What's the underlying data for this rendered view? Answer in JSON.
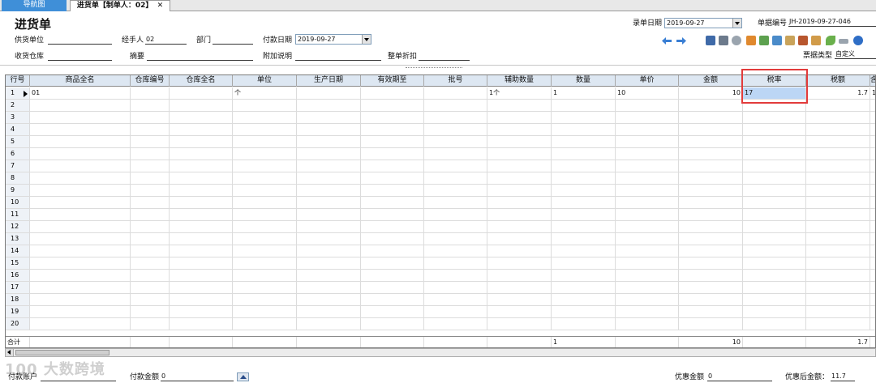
{
  "tabs": {
    "nav": "导航图",
    "doc": "进货单【制单人：02】",
    "close": "✕"
  },
  "page_title": "进货单",
  "header": {
    "entry_date_label": "录单日期",
    "entry_date_value": "2019-09-27",
    "doc_no_label": "单据编号",
    "doc_no_value": "JH-2019-09-27-046",
    "supplier_label": "供货单位",
    "handler_label": "经手人",
    "handler_value": "02",
    "dept_label": "部门",
    "pay_date_label": "付款日期",
    "pay_date_value": "2019-09-27",
    "warehouse_label": "收货仓库",
    "summary_label": "摘要",
    "note_label": "附加说明",
    "discount_label": "整单折扣",
    "bill_type_label": "票据类型",
    "bill_type_value": "自定义"
  },
  "columns": [
    "行号",
    "商品全名",
    "仓库编号",
    "仓库全名",
    "单位",
    "生产日期",
    "有效期至",
    "批号",
    "辅助数量",
    "数量",
    "单价",
    "金额",
    "税率",
    "税额",
    "含"
  ],
  "first_row": {
    "no": "1",
    "product": "01",
    "unit": "个",
    "aux_qty": "1个",
    "qty": "1",
    "price": "10",
    "amount": "10",
    "tax_rate": "17",
    "tax_amount": "1.7",
    "extra": "1"
  },
  "row_numbers": [
    "2",
    "3",
    "4",
    "5",
    "6",
    "7",
    "8",
    "9",
    "10",
    "11",
    "12",
    "13",
    "14",
    "15",
    "16",
    "17",
    "18",
    "19",
    "20"
  ],
  "totals": {
    "label": "合计",
    "qty": "1",
    "amount": "10",
    "tax_amount": "1.7"
  },
  "footer": {
    "pay_account_label": "付款账户",
    "pay_amount_label": "付款金额",
    "pay_amount_value": "0",
    "discount_amount_label": "优惠金额",
    "discount_amount_value": "0",
    "after_discount_label": "优惠后金额：",
    "after_discount_value": "11.7"
  },
  "watermark": "100 大数跨境",
  "colors": {
    "accent": "#3f8fd8",
    "header_bg": "#dde7f2",
    "selection": "#bcd6f5",
    "highlight": "#e23b3b"
  }
}
